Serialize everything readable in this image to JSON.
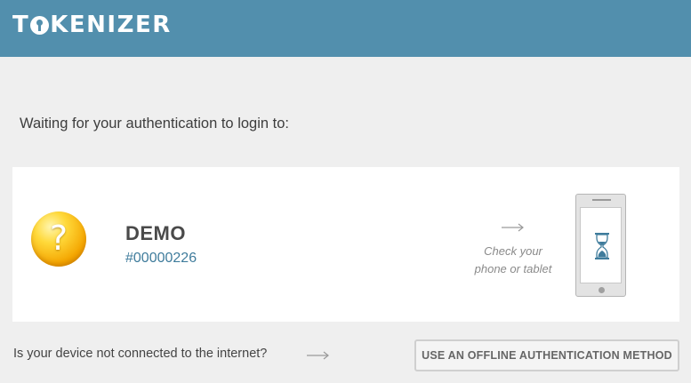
{
  "header": {
    "logo_text_prefix": "T",
    "logo_text_suffix": "KENIZER",
    "background_color": "#528fad"
  },
  "main": {
    "waiting_text": "Waiting for your authentication to login to:",
    "account": {
      "name": "DEMO",
      "id": "#00000226",
      "avatar_icon": "question-mark-icon",
      "avatar_glyph": "?"
    },
    "device_hint": {
      "line1": "Check your",
      "line2": "phone or tablet",
      "device_icon": "phone-icon",
      "status_icon": "hourglass-icon"
    }
  },
  "footer": {
    "offline_question": "Is your device not connected to the internet?",
    "offline_button_label": "USE AN OFFLINE AUTHENTICATION METHOD"
  },
  "colors": {
    "accent": "#528fad",
    "account_id": "#3f7c9c",
    "page_background": "#efefef"
  }
}
